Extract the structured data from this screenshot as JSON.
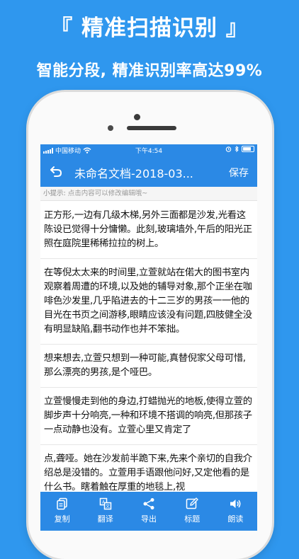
{
  "promo": {
    "title": "『 精准扫描识别 』",
    "subtitle": "智能分段, 精准识别率高达99%"
  },
  "status_bar": {
    "carrier": "中国移动",
    "time": "下午4:54"
  },
  "nav": {
    "title": "未命名文档-2018-03...",
    "save_label": "保存"
  },
  "tip": {
    "label": "小提示:",
    "text": "点击内容可以修改编辑哦~"
  },
  "paragraphs": [
    "正方形,一边有几级木梯,另外三面都是沙发,光看这陈设已觉得十分慵懒。此刻,玻璃墙外,午后的阳光正照在庭院里稀稀拉拉的树上。",
    "在等倪太太来的时间里,立萱就站在偌大的图书室内观察着周遭的环境,以及她的辅导对象,那个正坐在咖啡色沙发里,几乎陷进去的十二三岁的男孩一一他的目光在书页之间游移,眼睛应该没有问题,四肢健全没有明显缺陷,翻书动作也并不笨拙。",
    "想来想去,立萱只想到一种可能,真替倪家父母可惜,那么漂亮的男孩,是个哑巴。",
    "立萱慢慢走到他的身边,打蜡抛光的地板,使得立萱的脚步声十分响亮,一种和环境不搭调的响亮,但那孩子一点动静也没有。立萱心里又肯定了",
    "点,聋哑。她在沙发前半跪下来,先来个亲切的自我介绍总是没错的。立萱用手语跟他问好,又定他看的是什么书。瞎着触在厚重的地毯上,视"
  ],
  "toolbar": {
    "items": [
      {
        "label": "复制",
        "icon": "copy-icon"
      },
      {
        "label": "翻译",
        "icon": "translate-icon"
      },
      {
        "label": "导出",
        "icon": "share-icon"
      },
      {
        "label": "标题",
        "icon": "edit-icon"
      },
      {
        "label": "朗读",
        "icon": "speaker-icon"
      }
    ]
  },
  "colors": {
    "background": "#2f97ee",
    "bar": "#2b89e5",
    "text": "#111111"
  }
}
